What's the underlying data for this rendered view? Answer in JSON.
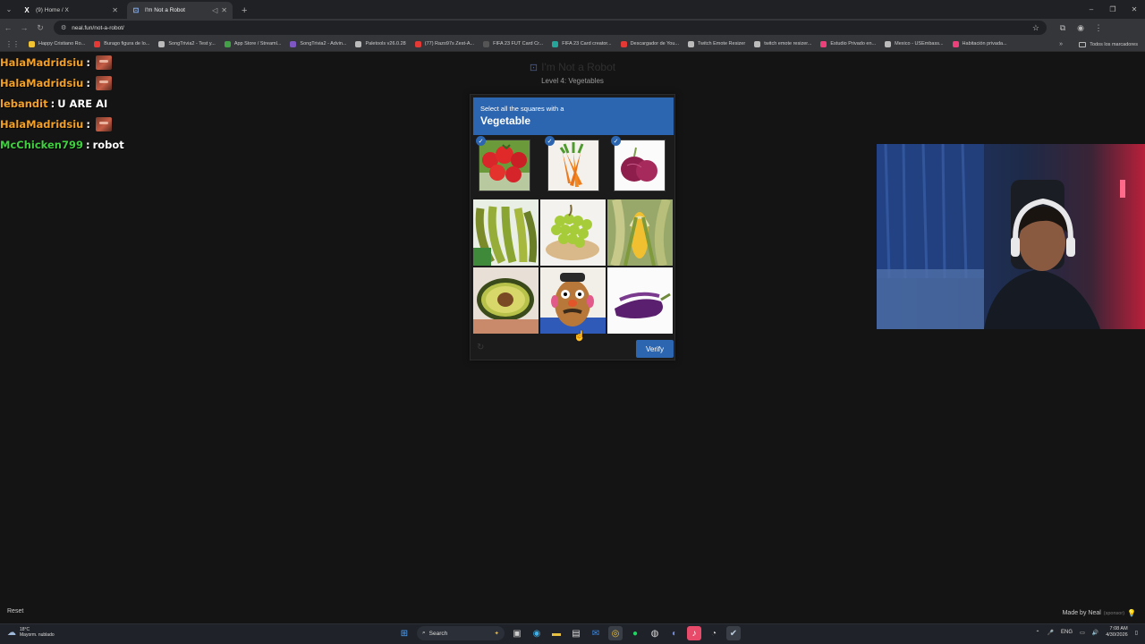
{
  "browser": {
    "tabs": [
      {
        "title": "(9) Home / X",
        "icon": "x-logo-icon",
        "active": false
      },
      {
        "title": "I'm Not a Robot",
        "icon": "robot-favicon-icon",
        "active": true
      }
    ],
    "url": "neal.fun/not-a-robot/",
    "bookmarks": [
      {
        "label": "Happy Cristiano Ro...",
        "color": "#f1c232"
      },
      {
        "label": "Burago figura de lo...",
        "color": "#e53935"
      },
      {
        "label": "SongTrivia2 - Test y...",
        "color": "#bbbbbb"
      },
      {
        "label": "App Store / Streaml...",
        "color": "#43a047"
      },
      {
        "label": "SongTrivia2 - Advin...",
        "color": "#7e57c2"
      },
      {
        "label": "Paletools v26.0.28",
        "color": "#bbbbbb"
      },
      {
        "label": "(77) Razo97s Zest-A...",
        "color": "#e53935"
      },
      {
        "label": "FIFA 23 FUT Card Cr...",
        "color": "#555555"
      },
      {
        "label": "FIFA 23 Card creator...",
        "color": "#26a69a"
      },
      {
        "label": "Descargador de You...",
        "color": "#e53935"
      },
      {
        "label": "Twitch Emote Resizer",
        "color": "#bbbbbb"
      },
      {
        "label": "twitch emote resizer...",
        "color": "#bbbbbb"
      },
      {
        "label": "Estudio Privado en...",
        "color": "#ec407a"
      },
      {
        "label": "Mexico - USEmbass...",
        "color": "#bbbbbb"
      },
      {
        "label": "Habitación privada...",
        "color": "#ec407a"
      }
    ],
    "bookmarks_folder": "Todos los marcadores"
  },
  "chat": [
    {
      "user": "HalaMadridsiu",
      "sep": ":",
      "text": "",
      "emote": true,
      "color": "#f4a024"
    },
    {
      "user": "HalaMadridsiu",
      "sep": ":",
      "text": "",
      "emote": true,
      "color": "#f4a024"
    },
    {
      "user": "lebandit",
      "sep": ":",
      "text": "U ARE AI",
      "emote": false,
      "color": "#f4a024"
    },
    {
      "user": "HalaMadridsiu",
      "sep": ":",
      "text": "",
      "emote": true,
      "color": "#f4a024"
    },
    {
      "user": "McChicken799",
      "sep": ":",
      "text": "robot",
      "emote": false,
      "color": "#3fcf3f"
    }
  ],
  "captcha": {
    "title": "I'm Not a Robot",
    "level": "Level 4: Vegetables",
    "prompt_line1": "Select all the squares with a",
    "prompt_target": "Vegetable",
    "selected": [
      {
        "name": "tomatoes-image",
        "checked": true
      },
      {
        "name": "carrots-image",
        "checked": true
      },
      {
        "name": "red-onion-image",
        "checked": true
      }
    ],
    "grid": [
      "bananas-image",
      "grapes-image",
      "corn-image",
      "avocado-image",
      "mr-potato-head-image",
      "eggplant-image"
    ],
    "verify_label": "Verify"
  },
  "footer": {
    "reset_label": "Reset",
    "made_by": "Made by Neal",
    "sponsor_tag": "(sponsor)"
  },
  "taskbar": {
    "weather_temp": "18°C",
    "weather_desc": "Mayorm. nublado",
    "search_label": "Search",
    "lang": "ENG",
    "time": "7:08 AM",
    "date": "4/30/2026"
  },
  "colors": {
    "accent_blue": "#2c66b0",
    "page_bg": "#141414"
  }
}
